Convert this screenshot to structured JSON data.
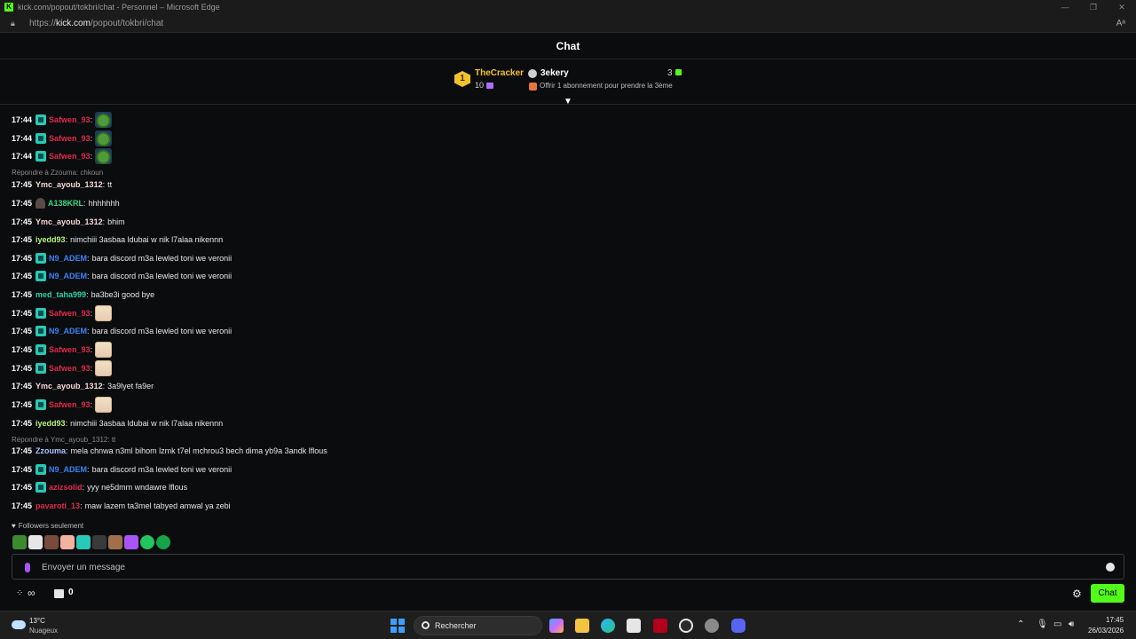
{
  "window": {
    "title": "kick.com/popout/tokbri/chat - Personnel – Microsoft Edge",
    "url_prefix": "https://",
    "url_domain": "kick.com",
    "url_path": "/popout/tokbri/chat"
  },
  "chat": {
    "title": "Chat",
    "leaderboard": {
      "rank": "1",
      "top_name": "TheCracker",
      "top_count": "10",
      "second_name": "3ekery",
      "second_count": "3",
      "offer": "Offrir 1 abonnement pour prendre la 3ème"
    },
    "messages": [
      {
        "time": "17:44",
        "user": "Safwen_93",
        "color": "#e0294b",
        "badge": "sub",
        "text": "",
        "emote": "pepe"
      },
      {
        "time": "17:44",
        "user": "Safwen_93",
        "color": "#e0294b",
        "badge": "sub",
        "text": "",
        "emote": "pepe"
      },
      {
        "time": "17:44",
        "user": "Safwen_93",
        "color": "#e0294b",
        "badge": "sub",
        "text": "",
        "emote": "pepe"
      },
      {
        "reply": "Répondre à Zzouma: chkoun"
      },
      {
        "time": "17:45",
        "user": "Ymc_ayoub_1312",
        "color": "#f3d7d7",
        "badge": "",
        "text": "tt",
        "emote": ""
      },
      {
        "time": "17:45",
        "user": "A138KRL",
        "color": "#39d98a",
        "badge": "avatar",
        "text": "hhhhhhh",
        "emote": ""
      },
      {
        "time": "17:45",
        "user": "Ymc_ayoub_1312",
        "color": "#f3d7d7",
        "badge": "",
        "text": "bhim",
        "emote": ""
      },
      {
        "time": "17:45",
        "user": "iyedd93",
        "color": "#b6f27a",
        "badge": "",
        "text": "nimchiii 3asbaa ldubai w nik l7alaa nikennn",
        "emote": ""
      },
      {
        "time": "17:45",
        "user": "N9_ADEM",
        "color": "#3b82f6",
        "badge": "sub",
        "text": "bara discord m3a lewled toni we veronii",
        "emote": ""
      },
      {
        "time": "17:45",
        "user": "N9_ADEM",
        "color": "#3b82f6",
        "badge": "sub",
        "text": "bara discord m3a lewled toni we veronii",
        "emote": ""
      },
      {
        "time": "17:45",
        "user": "med_taha999",
        "color": "#2dd4a7",
        "badge": "",
        "text": "ba3be3i good bye",
        "emote": ""
      },
      {
        "time": "17:45",
        "user": "Safwen_93",
        "color": "#e0294b",
        "badge": "sub",
        "text": "",
        "emote": "anime"
      },
      {
        "time": "17:45",
        "user": "N9_ADEM",
        "color": "#3b82f6",
        "badge": "sub",
        "text": "bara discord m3a lewled toni we veronii",
        "emote": ""
      },
      {
        "time": "17:45",
        "user": "Safwen_93",
        "color": "#e0294b",
        "badge": "sub",
        "text": "",
        "emote": "anime"
      },
      {
        "time": "17:45",
        "user": "Safwen_93",
        "color": "#e0294b",
        "badge": "sub",
        "text": "",
        "emote": "anime"
      },
      {
        "time": "17:45",
        "user": "Ymc_ayoub_1312",
        "color": "#f3d7d7",
        "badge": "",
        "text": "3a9lyet fa9er",
        "emote": ""
      },
      {
        "time": "17:45",
        "user": "Safwen_93",
        "color": "#e0294b",
        "badge": "sub",
        "text": "",
        "emote": "anime"
      },
      {
        "time": "17:45",
        "user": "iyedd93",
        "color": "#b6f27a",
        "badge": "",
        "text": "nimchiii 3asbaa ldubai w nik l7alaa nikennn",
        "emote": ""
      },
      {
        "reply": "Répondre à Ymc_ayoub_1312: tt"
      },
      {
        "time": "17:45",
        "user": "Zzouma",
        "color": "#a5c8ff",
        "badge": "",
        "text": "mela chnwa n3ml bihom lzmk t7el mchrou3 bech dima yb9a 3andk lflous",
        "emote": ""
      },
      {
        "time": "17:45",
        "user": "N9_ADEM",
        "color": "#3b82f6",
        "badge": "sub",
        "text": "bara discord m3a lewled toni we veronii",
        "emote": ""
      },
      {
        "time": "17:45",
        "user": "azizsolid",
        "color": "#e0294b",
        "badge": "sub",
        "text": "yyy ne5dmm wndawre lflous",
        "emote": ""
      },
      {
        "time": "17:45",
        "user": "pavaroti_13",
        "color": "#e0294b",
        "badge": "",
        "text": "maw lazem ta3mel tabyed amwal ya zebi",
        "emote": ""
      }
    ],
    "followers_only": "Followers seulement",
    "input_placeholder": "Envoyer un message",
    "gift_count": "0",
    "send_label": "Chat"
  },
  "taskbar": {
    "weather_temp": "13°C",
    "weather_desc": "Nuageux",
    "search_label": "Rechercher",
    "time": "17:45",
    "date": "26/03/2026"
  },
  "colors": {
    "accent": "#53fc18",
    "background": "#0b0c0e"
  }
}
